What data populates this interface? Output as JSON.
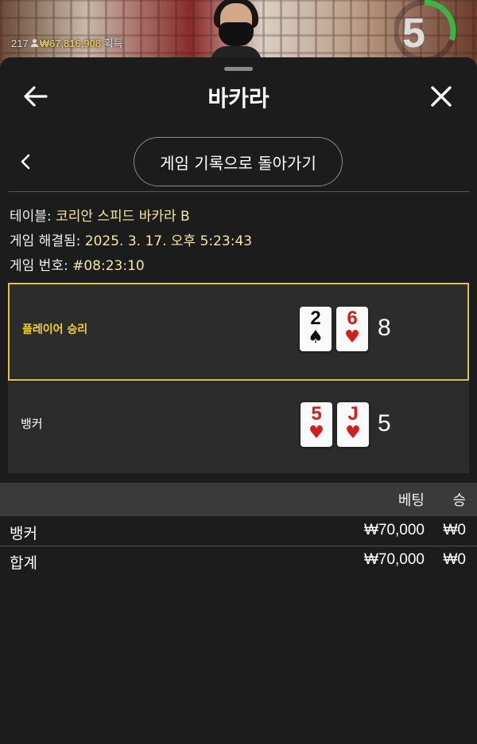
{
  "stream": {
    "viewer_count": "217",
    "win_amount": "₩67,816,908",
    "win_suffix": "획득",
    "timer_value": "5",
    "timer_fraction": 0.3
  },
  "header": {
    "title": "바카라"
  },
  "subnav": {
    "history_button_label": "게임 기록으로 돌아가기"
  },
  "info": {
    "table_label": "테이블:",
    "table_value": "코리안 스피드 바카라 B",
    "resolved_label": "게임 해결됨:",
    "resolved_value": "2025. 3. 17. 오후 5:23:43",
    "game_no_label": "게임 번호:",
    "game_no_value": "#08:23:10"
  },
  "result": {
    "player": {
      "label": "플레이어 승리",
      "cards": [
        {
          "rank": "2",
          "suit": "♠",
          "color": "black"
        },
        {
          "rank": "6",
          "suit": "♥",
          "color": "red"
        }
      ],
      "score": "8"
    },
    "banker": {
      "label": "뱅커",
      "cards": [
        {
          "rank": "5",
          "suit": "♥",
          "color": "red"
        },
        {
          "rank": "J",
          "suit": "♥",
          "color": "red"
        }
      ],
      "score": "5"
    }
  },
  "bets_table": {
    "headers": {
      "bet": "베팅",
      "win": "승"
    },
    "rows": [
      {
        "name": "뱅커",
        "bet": "₩70,000",
        "win": "₩0"
      },
      {
        "name": "합계",
        "bet": "₩70,000",
        "win": "₩0"
      }
    ]
  },
  "colors": {
    "accent_gold": "#e0c33c",
    "timer_green": "#3cb44a",
    "card_red": "#d0201e"
  }
}
